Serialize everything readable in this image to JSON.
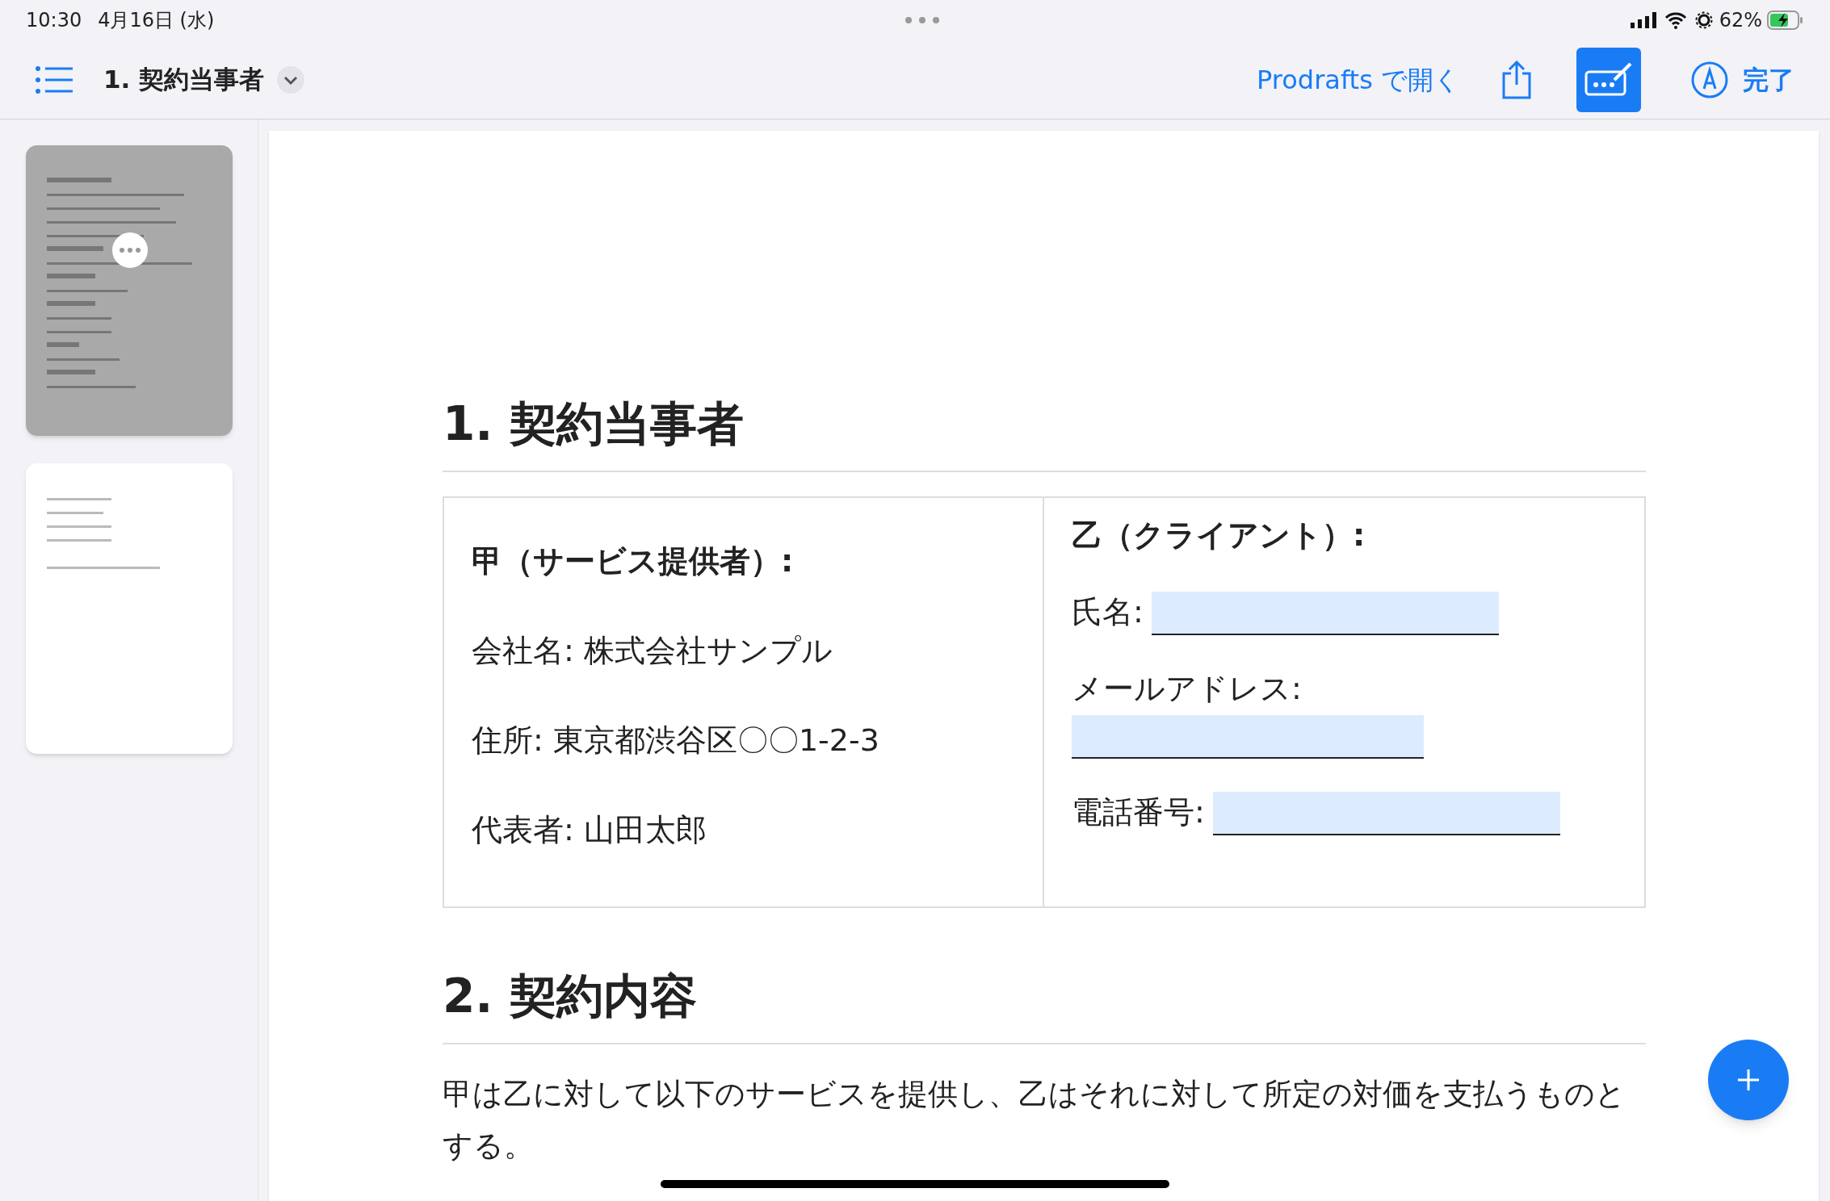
{
  "status_bar": {
    "time": "10:30",
    "date": "4月16日 (水)",
    "battery": "62%"
  },
  "toolbar": {
    "title": "1. 契約当事者",
    "open_in": "Prodrafts で開く",
    "markup_selected": true,
    "done": "完了"
  },
  "thumbnails": [
    {
      "selected": true
    },
    {
      "selected": false
    }
  ],
  "document": {
    "section_1": {
      "heading": "1. 契約当事者",
      "left": {
        "title": "甲（サービス提供者）:",
        "lines": [
          "会社名: 株式会社サンプル",
          "住所: 東京都渋谷区〇〇1-2-3",
          "代表者: 山田太郎"
        ]
      },
      "right": {
        "title": "乙（クライアント）:",
        "fields": [
          {
            "label": "氏名:",
            "kind": "inline"
          },
          {
            "label": "メールアドレス:",
            "kind": "below"
          },
          {
            "label": "電話番号:",
            "kind": "inline"
          }
        ]
      }
    },
    "section_2": {
      "heading": "2. 契約内容",
      "paragraph": "甲は乙に対して以下のサービスを提供し、乙はそれに対して所定の対価を支払うものとする。"
    }
  }
}
